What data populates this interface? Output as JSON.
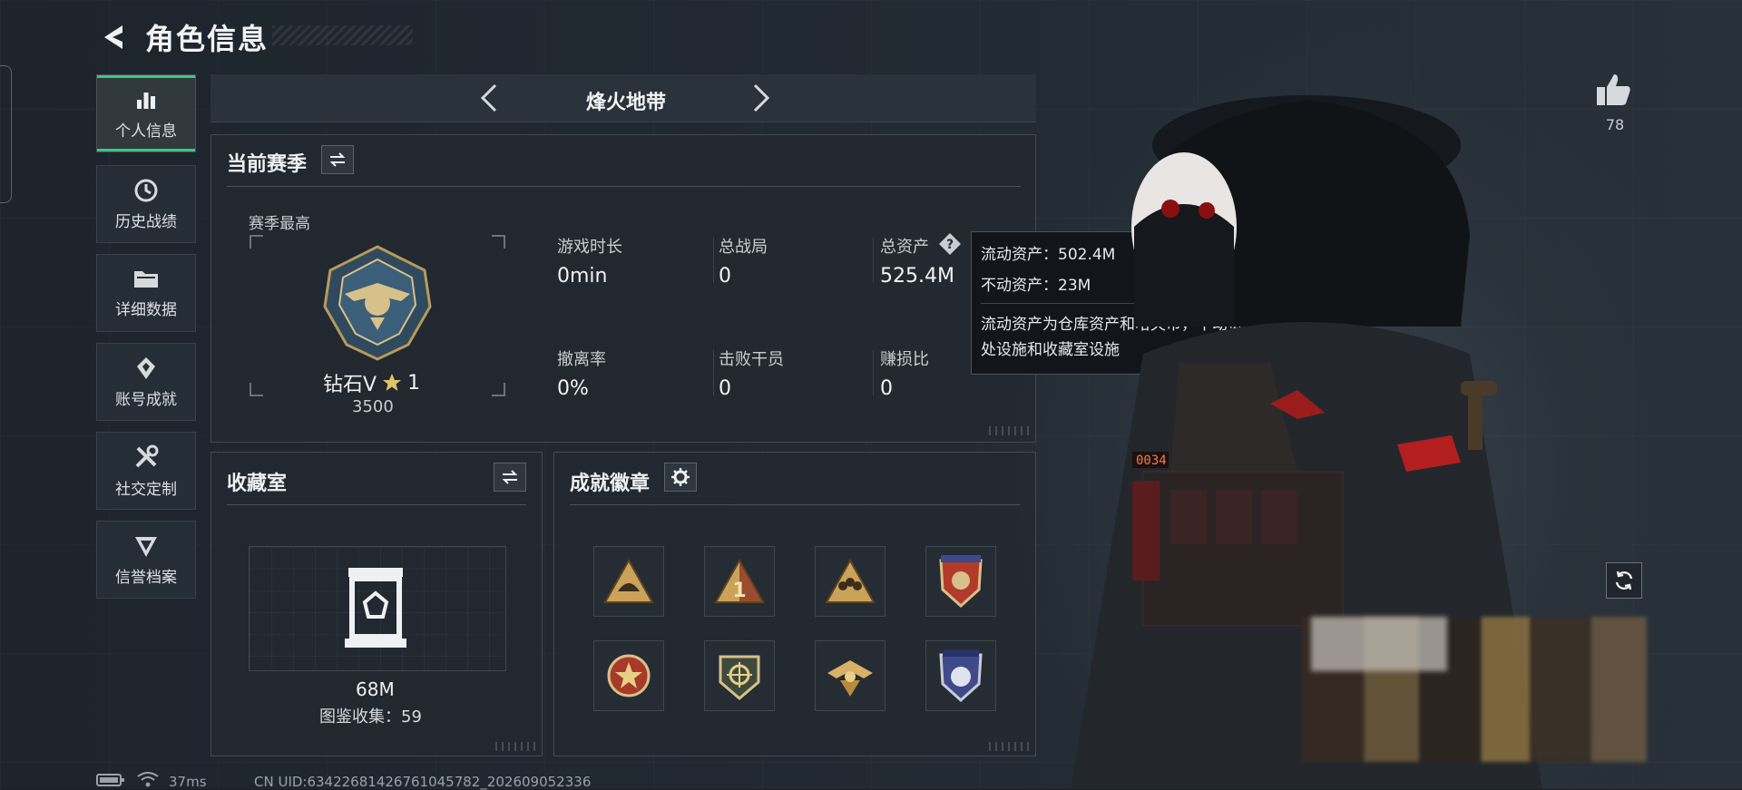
{
  "header": {
    "title": "角色信息"
  },
  "sidebar": {
    "items": [
      {
        "label": "个人信息",
        "icon": "bar-chart-icon",
        "active": true
      },
      {
        "label": "历史战绩",
        "icon": "history-clock-icon"
      },
      {
        "label": "详细数据",
        "icon": "folder-icon"
      },
      {
        "label": "账号成就",
        "icon": "achievement-medal-icon"
      },
      {
        "label": "社交定制",
        "icon": "tools-icon"
      },
      {
        "label": "信誉档案",
        "icon": "shield-wing-icon"
      }
    ]
  },
  "mode_selector": {
    "name": "烽火地带"
  },
  "season": {
    "title": "当前赛季",
    "best_label": "赛季最高",
    "rank_name": "钻石V",
    "rank_stars": "1",
    "rank_points": "3500",
    "stats": [
      {
        "label": "游戏时长",
        "value": "0min"
      },
      {
        "label": "总战局",
        "value": "0"
      },
      {
        "label": "总资产",
        "value": "525.4M"
      },
      {
        "label": "撤离率",
        "value": "0%"
      },
      {
        "label": "击败干员",
        "value": "0"
      },
      {
        "label": "赚损比",
        "value": "0"
      }
    ]
  },
  "tooltip": {
    "liquid": "流动资产：502.4M",
    "fixed": "不动资产：23M",
    "description": "流动资产为仓库资产和哈夫币，不动资产为特勤处设施和收藏室设施"
  },
  "collection": {
    "title": "收藏室",
    "value": "68M",
    "collected": "图鉴收集：59"
  },
  "achievements": {
    "title": "成就徽章",
    "badges": [
      "helmet-badge-icon",
      "number-one-badge-icon",
      "squad-badge-icon",
      "shield-eagle-badge-icon",
      "star-wings-badge-icon",
      "crosshair-badge-icon",
      "eagle-badge-icon",
      "star-shield-badge-icon"
    ]
  },
  "profile": {
    "likes": "78"
  },
  "footer": {
    "ping": "37ms",
    "uid": "CN UID:634226814267610457​82_202609052336"
  }
}
